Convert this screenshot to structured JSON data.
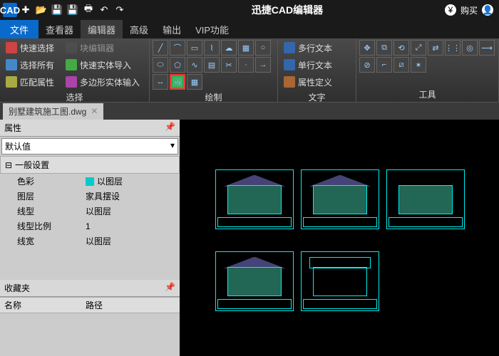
{
  "app": {
    "title": "迅捷CAD编辑器",
    "buy": "购买",
    "cadLogo": "CAD"
  },
  "menu": {
    "file": "文件",
    "tabs": [
      "查看器",
      "编辑器",
      "高级",
      "输出",
      "VIP功能"
    ],
    "active": 1
  },
  "ribbon": {
    "select": {
      "label": "选择",
      "quick": "快速选择",
      "all": "选择所有",
      "match": "匹配属性",
      "editor": "块编辑器",
      "import": "快速实体导入",
      "polyInput": "多边形实体输入"
    },
    "draw": {
      "label": "绘制"
    },
    "text": {
      "label": "文字",
      "multi": "多行文本",
      "single": "单行文本",
      "attr": "属性定义"
    },
    "tools": {
      "label": "工具"
    }
  },
  "doc": {
    "name": "别墅建筑施工图.dwg"
  },
  "props": {
    "title": "属性",
    "default": "默认值",
    "general": "一般设置",
    "rows": [
      {
        "k": "色彩",
        "v": "以图层",
        "sw": true
      },
      {
        "k": "图层",
        "v": "家具摆设"
      },
      {
        "k": "线型",
        "v": "以图层"
      },
      {
        "k": "线型比例",
        "v": "1"
      },
      {
        "k": "线宽",
        "v": "以图层"
      }
    ],
    "fav": "收藏夹",
    "name": "名称",
    "path": "路径"
  }
}
